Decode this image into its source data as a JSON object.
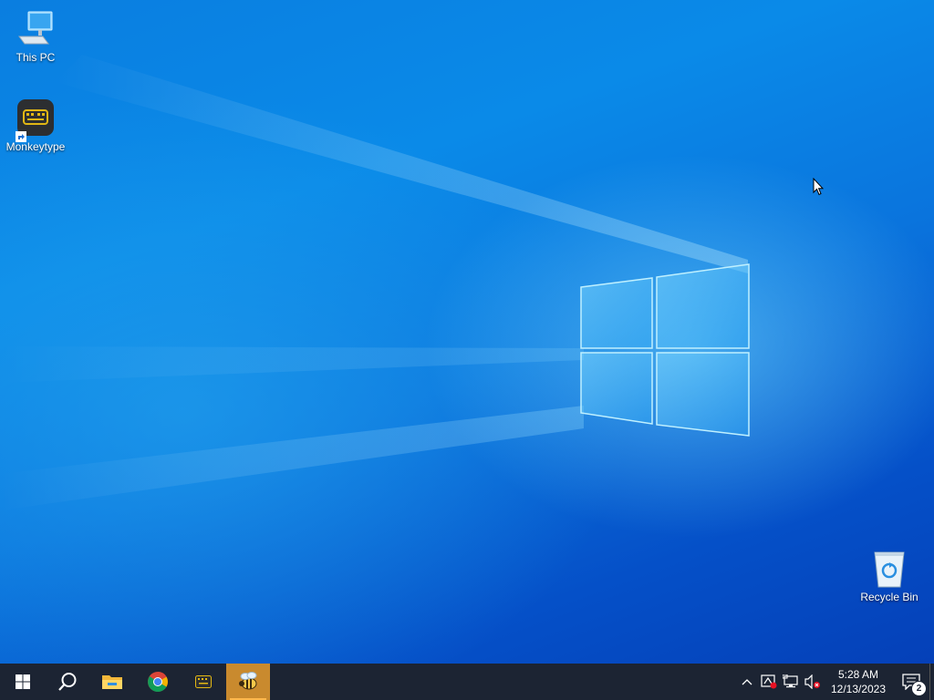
{
  "desktop": {
    "icons": [
      {
        "label": "This PC",
        "icon": "this-pc-icon"
      },
      {
        "label": "Monkeytype",
        "icon": "monkeytype-icon"
      },
      {
        "label": "Recycle Bin",
        "icon": "recycle-bin-icon"
      }
    ]
  },
  "taskbar": {
    "items": [
      {
        "name": "start-button",
        "icon": "windows-logo-icon"
      },
      {
        "name": "search-button",
        "icon": "search-icon"
      },
      {
        "name": "file-explorer-button",
        "icon": "folder-icon"
      },
      {
        "name": "chrome-button",
        "icon": "chrome-icon"
      },
      {
        "name": "monkeytype-button",
        "icon": "monkeytype-icon"
      },
      {
        "name": "app-button",
        "icon": "bee-icon"
      }
    ],
    "accent": "#c98a2e"
  },
  "tray": {
    "time": "5:28 AM",
    "date": "12/13/2023",
    "notification_count": "2"
  }
}
